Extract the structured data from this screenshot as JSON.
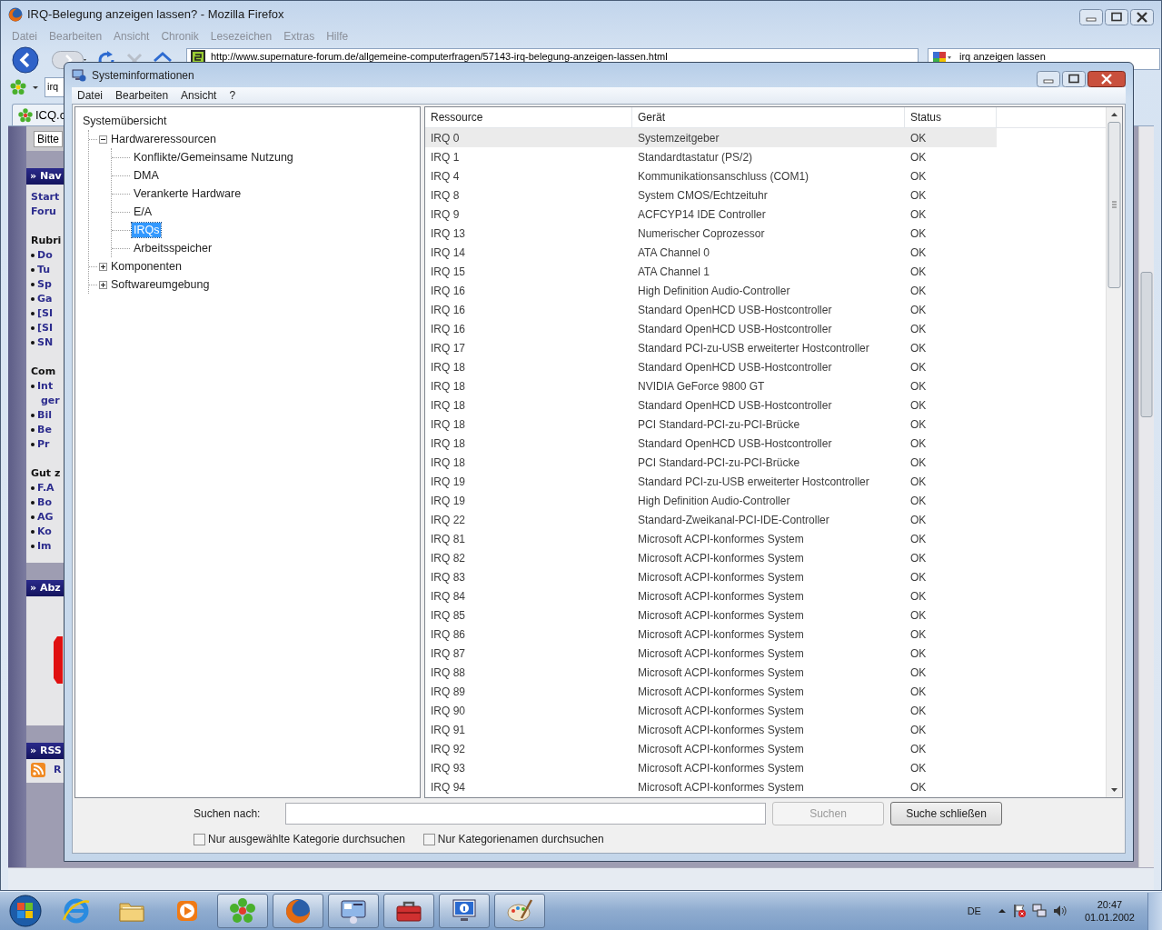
{
  "browser": {
    "title": "IRQ-Belegung anzeigen lassen? - Mozilla Firefox",
    "menu": [
      "Datei",
      "Bearbeiten",
      "Ansicht",
      "Chronik",
      "Lesezeichen",
      "Extras",
      "Hilfe"
    ],
    "url": "http://www.supernature-forum.de/allgemeine-computerfragen/57143-irq-belegung-anzeigen-lassen.html",
    "search": "irq anzeigen lassen",
    "bookmark_field": "irq",
    "tab": "ICQ.c",
    "page_button": "Bitte",
    "sidebar": [
      {
        "kind": "header",
        "text": "» Nav"
      },
      {
        "kind": "link",
        "text": "Start"
      },
      {
        "kind": "link",
        "text": "Foru"
      },
      {
        "kind": "heading",
        "text": "Rubri"
      },
      {
        "kind": "bullet",
        "text": "Do"
      },
      {
        "kind": "bullet",
        "text": "Tu"
      },
      {
        "kind": "bullet",
        "text": "Sp"
      },
      {
        "kind": "bullet",
        "text": "Ga"
      },
      {
        "kind": "bullet",
        "text": "[SI"
      },
      {
        "kind": "bullet",
        "text": "[SI"
      },
      {
        "kind": "bullet",
        "text": "SN"
      },
      {
        "kind": "heading",
        "text": "Com"
      },
      {
        "kind": "bullet",
        "text": "Int"
      },
      {
        "kind": "cont",
        "text": "ger"
      },
      {
        "kind": "bullet",
        "text": "Bil"
      },
      {
        "kind": "bullet",
        "text": "Be"
      },
      {
        "kind": "bullet",
        "text": "Pr"
      },
      {
        "kind": "heading",
        "text": "Gut z"
      },
      {
        "kind": "bullet",
        "text": "F.A"
      },
      {
        "kind": "bullet",
        "text": "Bo"
      },
      {
        "kind": "bullet",
        "text": "AG"
      },
      {
        "kind": "bullet",
        "text": "Ko"
      },
      {
        "kind": "bullet",
        "text": "Im"
      },
      {
        "kind": "header",
        "text": "» Abz"
      },
      {
        "kind": "sign"
      },
      {
        "kind": "header",
        "text": "» RSS"
      },
      {
        "kind": "rss",
        "text": "R"
      }
    ]
  },
  "dialog": {
    "title": "Systeminformationen",
    "menu": [
      "Datei",
      "Bearbeiten",
      "Ansicht",
      "?"
    ],
    "tree": [
      {
        "label": "Systemübersicht",
        "selected": false,
        "children": [
          {
            "label": "Hardwareressourcen",
            "expanded": true,
            "selected": false,
            "children": [
              {
                "label": "Konflikte/Gemeinsame Nutzung",
                "selected": false
              },
              {
                "label": "DMA",
                "selected": false
              },
              {
                "label": "Verankerte Hardware",
                "selected": false
              },
              {
                "label": "E/A",
                "selected": false
              },
              {
                "label": "IRQs",
                "selected": true
              },
              {
                "label": "Arbeitsspeicher",
                "selected": false
              }
            ]
          },
          {
            "label": "Komponenten",
            "expanded": false,
            "selected": false
          },
          {
            "label": "Softwareumgebung",
            "expanded": false,
            "selected": false
          }
        ]
      }
    ],
    "columns": [
      "Ressource",
      "Gerät",
      "Status"
    ],
    "rows": [
      {
        "resource": "IRQ 0",
        "device": "Systemzeitgeber",
        "status": "OK",
        "selected": true
      },
      {
        "resource": "IRQ 1",
        "device": "Standardtastatur (PS/2)",
        "status": "OK",
        "selected": false
      },
      {
        "resource": "IRQ 4",
        "device": "Kommunikationsanschluss (COM1)",
        "status": "OK",
        "selected": false
      },
      {
        "resource": "IRQ 8",
        "device": "System CMOS/Echtzeituhr",
        "status": "OK",
        "selected": false
      },
      {
        "resource": "IRQ 9",
        "device": "ACFCYP14 IDE Controller",
        "status": "OK",
        "selected": false
      },
      {
        "resource": "IRQ 13",
        "device": "Numerischer Coprozessor",
        "status": "OK",
        "selected": false
      },
      {
        "resource": "IRQ 14",
        "device": "ATA Channel 0",
        "status": "OK",
        "selected": false
      },
      {
        "resource": "IRQ 15",
        "device": "ATA Channel 1",
        "status": "OK",
        "selected": false
      },
      {
        "resource": "IRQ 16",
        "device": "High Definition Audio-Controller",
        "status": "OK",
        "selected": false
      },
      {
        "resource": "IRQ 16",
        "device": "Standard OpenHCD USB-Hostcontroller",
        "status": "OK",
        "selected": false
      },
      {
        "resource": "IRQ 16",
        "device": "Standard OpenHCD USB-Hostcontroller",
        "status": "OK",
        "selected": false
      },
      {
        "resource": "IRQ 17",
        "device": "Standard PCI-zu-USB erweiterter Hostcontroller",
        "status": "OK",
        "selected": false
      },
      {
        "resource": "IRQ 18",
        "device": "Standard OpenHCD USB-Hostcontroller",
        "status": "OK",
        "selected": false
      },
      {
        "resource": "IRQ 18",
        "device": "NVIDIA GeForce 9800 GT",
        "status": "OK",
        "selected": false
      },
      {
        "resource": "IRQ 18",
        "device": "Standard OpenHCD USB-Hostcontroller",
        "status": "OK",
        "selected": false
      },
      {
        "resource": "IRQ 18",
        "device": "PCI Standard-PCI-zu-PCI-Brücke",
        "status": "OK",
        "selected": false
      },
      {
        "resource": "IRQ 18",
        "device": "Standard OpenHCD USB-Hostcontroller",
        "status": "OK",
        "selected": false
      },
      {
        "resource": "IRQ 18",
        "device": "PCI Standard-PCI-zu-PCI-Brücke",
        "status": "OK",
        "selected": false
      },
      {
        "resource": "IRQ 19",
        "device": "Standard PCI-zu-USB erweiterter Hostcontroller",
        "status": "OK",
        "selected": false
      },
      {
        "resource": "IRQ 19",
        "device": "High Definition Audio-Controller",
        "status": "OK",
        "selected": false
      },
      {
        "resource": "IRQ 22",
        "device": "Standard-Zweikanal-PCI-IDE-Controller",
        "status": "OK",
        "selected": false
      },
      {
        "resource": "IRQ 81",
        "device": "Microsoft ACPI-konformes System",
        "status": "OK",
        "selected": false
      },
      {
        "resource": "IRQ 82",
        "device": "Microsoft ACPI-konformes System",
        "status": "OK",
        "selected": false
      },
      {
        "resource": "IRQ 83",
        "device": "Microsoft ACPI-konformes System",
        "status": "OK",
        "selected": false
      },
      {
        "resource": "IRQ 84",
        "device": "Microsoft ACPI-konformes System",
        "status": "OK",
        "selected": false
      },
      {
        "resource": "IRQ 85",
        "device": "Microsoft ACPI-konformes System",
        "status": "OK",
        "selected": false
      },
      {
        "resource": "IRQ 86",
        "device": "Microsoft ACPI-konformes System",
        "status": "OK",
        "selected": false
      },
      {
        "resource": "IRQ 87",
        "device": "Microsoft ACPI-konformes System",
        "status": "OK",
        "selected": false
      },
      {
        "resource": "IRQ 88",
        "device": "Microsoft ACPI-konformes System",
        "status": "OK",
        "selected": false
      },
      {
        "resource": "IRQ 89",
        "device": "Microsoft ACPI-konformes System",
        "status": "OK",
        "selected": false
      },
      {
        "resource": "IRQ 90",
        "device": "Microsoft ACPI-konformes System",
        "status": "OK",
        "selected": false
      },
      {
        "resource": "IRQ 91",
        "device": "Microsoft ACPI-konformes System",
        "status": "OK",
        "selected": false
      },
      {
        "resource": "IRQ 92",
        "device": "Microsoft ACPI-konformes System",
        "status": "OK",
        "selected": false
      },
      {
        "resource": "IRQ 93",
        "device": "Microsoft ACPI-konformes System",
        "status": "OK",
        "selected": false
      },
      {
        "resource": "IRQ 94",
        "device": "Microsoft ACPI-konformes System",
        "status": "OK",
        "selected": false
      }
    ],
    "search": {
      "label": "Suchen nach:",
      "search_button": {
        "label": "Suchen",
        "disabled": true
      },
      "close_button": {
        "label": "Suche schließen",
        "disabled": false
      }
    },
    "options": [
      {
        "label": "Nur ausgewählte Kategorie durchsuchen",
        "checked": false
      },
      {
        "label": "Nur Kategorienamen durchsuchen",
        "checked": false
      }
    ]
  },
  "taskbar": {
    "apps": [
      {
        "kind": "ie",
        "running": false
      },
      {
        "kind": "folder",
        "running": false
      },
      {
        "kind": "media",
        "running": false
      },
      {
        "kind": "flower",
        "running": true
      },
      {
        "kind": "firefox",
        "running": true
      },
      {
        "kind": "sysinfo",
        "running": true
      },
      {
        "kind": "toolbox",
        "running": true
      },
      {
        "kind": "info",
        "running": true
      },
      {
        "kind": "paint",
        "running": true
      }
    ],
    "language": "DE",
    "time": "20:47",
    "date": "01.01.2002"
  }
}
